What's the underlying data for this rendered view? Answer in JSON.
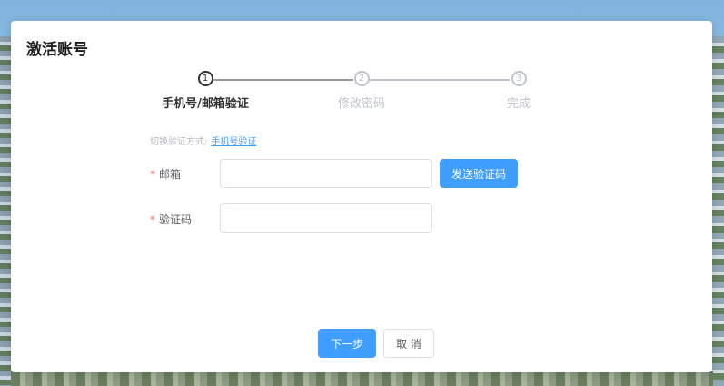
{
  "dialog": {
    "title": "激活账号"
  },
  "steps": [
    {
      "number": "1",
      "label": "手机号/邮箱验证",
      "active": true
    },
    {
      "number": "2",
      "label": "修改密码",
      "active": false
    },
    {
      "number": "3",
      "label": "完成",
      "active": false
    }
  ],
  "switch": {
    "prefix": "切换验证方式:",
    "link": "手机号验证"
  },
  "form": {
    "email": {
      "required_mark": "*",
      "label": "邮箱",
      "value": "",
      "placeholder": ""
    },
    "send_code_label": "发送验证码",
    "code": {
      "required_mark": "*",
      "label": "验证码",
      "value": "",
      "placeholder": ""
    }
  },
  "footer": {
    "next_label": "下一步",
    "cancel_label": "取 消"
  },
  "colors": {
    "primary": "#409eff",
    "required": "#f56c6c",
    "inactive": "#c0c4cc",
    "active": "#303133"
  }
}
